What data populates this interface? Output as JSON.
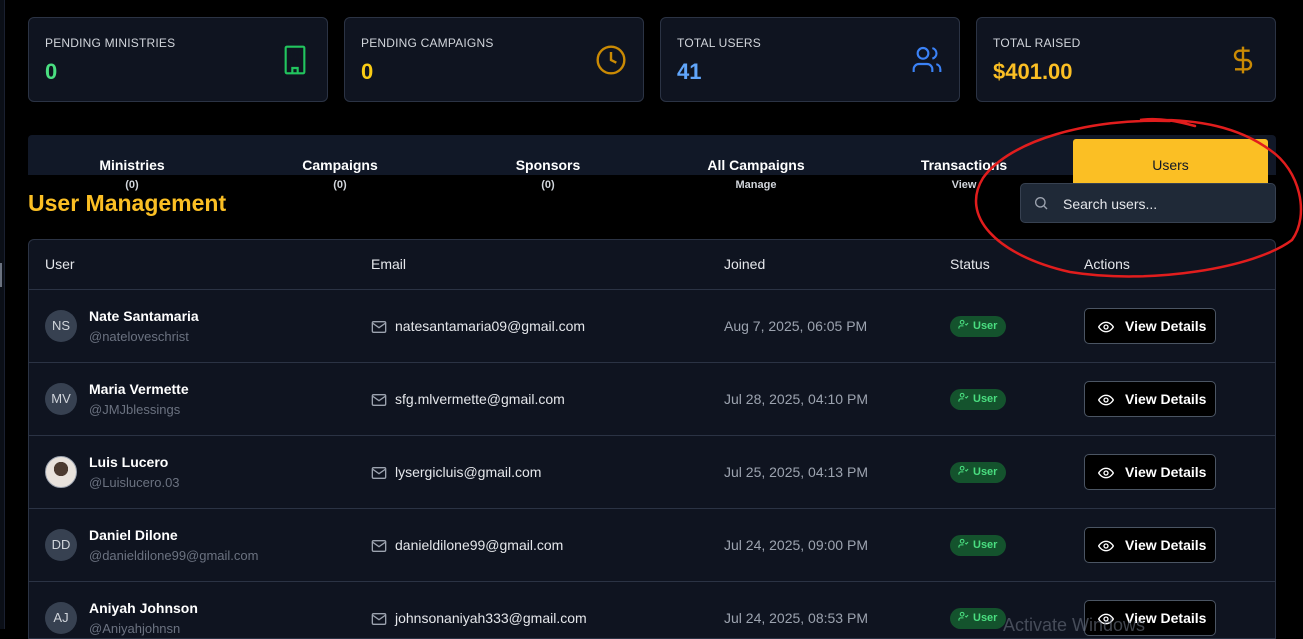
{
  "stats": [
    {
      "label": "PENDING MINISTRIES",
      "value": "0",
      "color": "#4ade80",
      "icon": "building-icon"
    },
    {
      "label": "PENDING CAMPAIGNS",
      "value": "0",
      "color": "#facc15",
      "icon": "clock-icon"
    },
    {
      "label": "TOTAL USERS",
      "value": "41",
      "color": "#60a5fa",
      "icon": "users-icon"
    },
    {
      "label": "TOTAL RAISED",
      "value": "$401.00",
      "color": "#fbbf24",
      "icon": "dollar-icon"
    }
  ],
  "tabs": [
    {
      "label": "Ministries",
      "sub": "(0)"
    },
    {
      "label": "Campaigns",
      "sub": "(0)"
    },
    {
      "label": "Sponsors",
      "sub": "(0)"
    },
    {
      "label": "All Campaigns",
      "sub": "Manage"
    },
    {
      "label": "Transactions",
      "sub": "View"
    },
    {
      "label": "Users",
      "sub": ""
    }
  ],
  "active_tab": "Users",
  "page_title": "User Management",
  "search": {
    "placeholder": "Search users...",
    "value": ""
  },
  "table": {
    "columns": [
      "User",
      "Email",
      "Joined",
      "Status",
      "Actions"
    ],
    "rows": [
      {
        "initials": "NS",
        "name": "Nate Santamaria",
        "handle": "@nateloveschrist",
        "email": "natesantamaria09@gmail.com",
        "joined": "Aug 7, 2025, 06:05 PM",
        "status": "User",
        "action": "View Details"
      },
      {
        "initials": "MV",
        "name": "Maria Vermette",
        "handle": "@JMJblessings",
        "email": "sfg.mlvermette@gmail.com",
        "joined": "Jul 28, 2025, 04:10 PM",
        "status": "User",
        "action": "View Details"
      },
      {
        "initials": "",
        "name": "Luis Lucero",
        "handle": "@Luislucero.03",
        "email": "lysergicluis@gmail.com",
        "joined": "Jul 25, 2025, 04:13 PM",
        "status": "User",
        "action": "View Details"
      },
      {
        "initials": "DD",
        "name": "Daniel Dilone",
        "handle": "@danieldilone99@gmail.com",
        "email": "danieldilone99@gmail.com",
        "joined": "Jul 24, 2025, 09:00 PM",
        "status": "User",
        "action": "View Details"
      },
      {
        "initials": "AJ",
        "name": "Aniyah Johnson",
        "handle": "@Aniyahjohnsn",
        "email": "johnsonaniyah333@gmail.com",
        "joined": "Jul 24, 2025, 08:53 PM",
        "status": "User",
        "action": "View Details"
      }
    ]
  },
  "os_watermark": "Activate Windows",
  "colors": {
    "accent": "#fbbf24",
    "status_green": "#4ade80",
    "annotation_red": "#e11d1d"
  }
}
